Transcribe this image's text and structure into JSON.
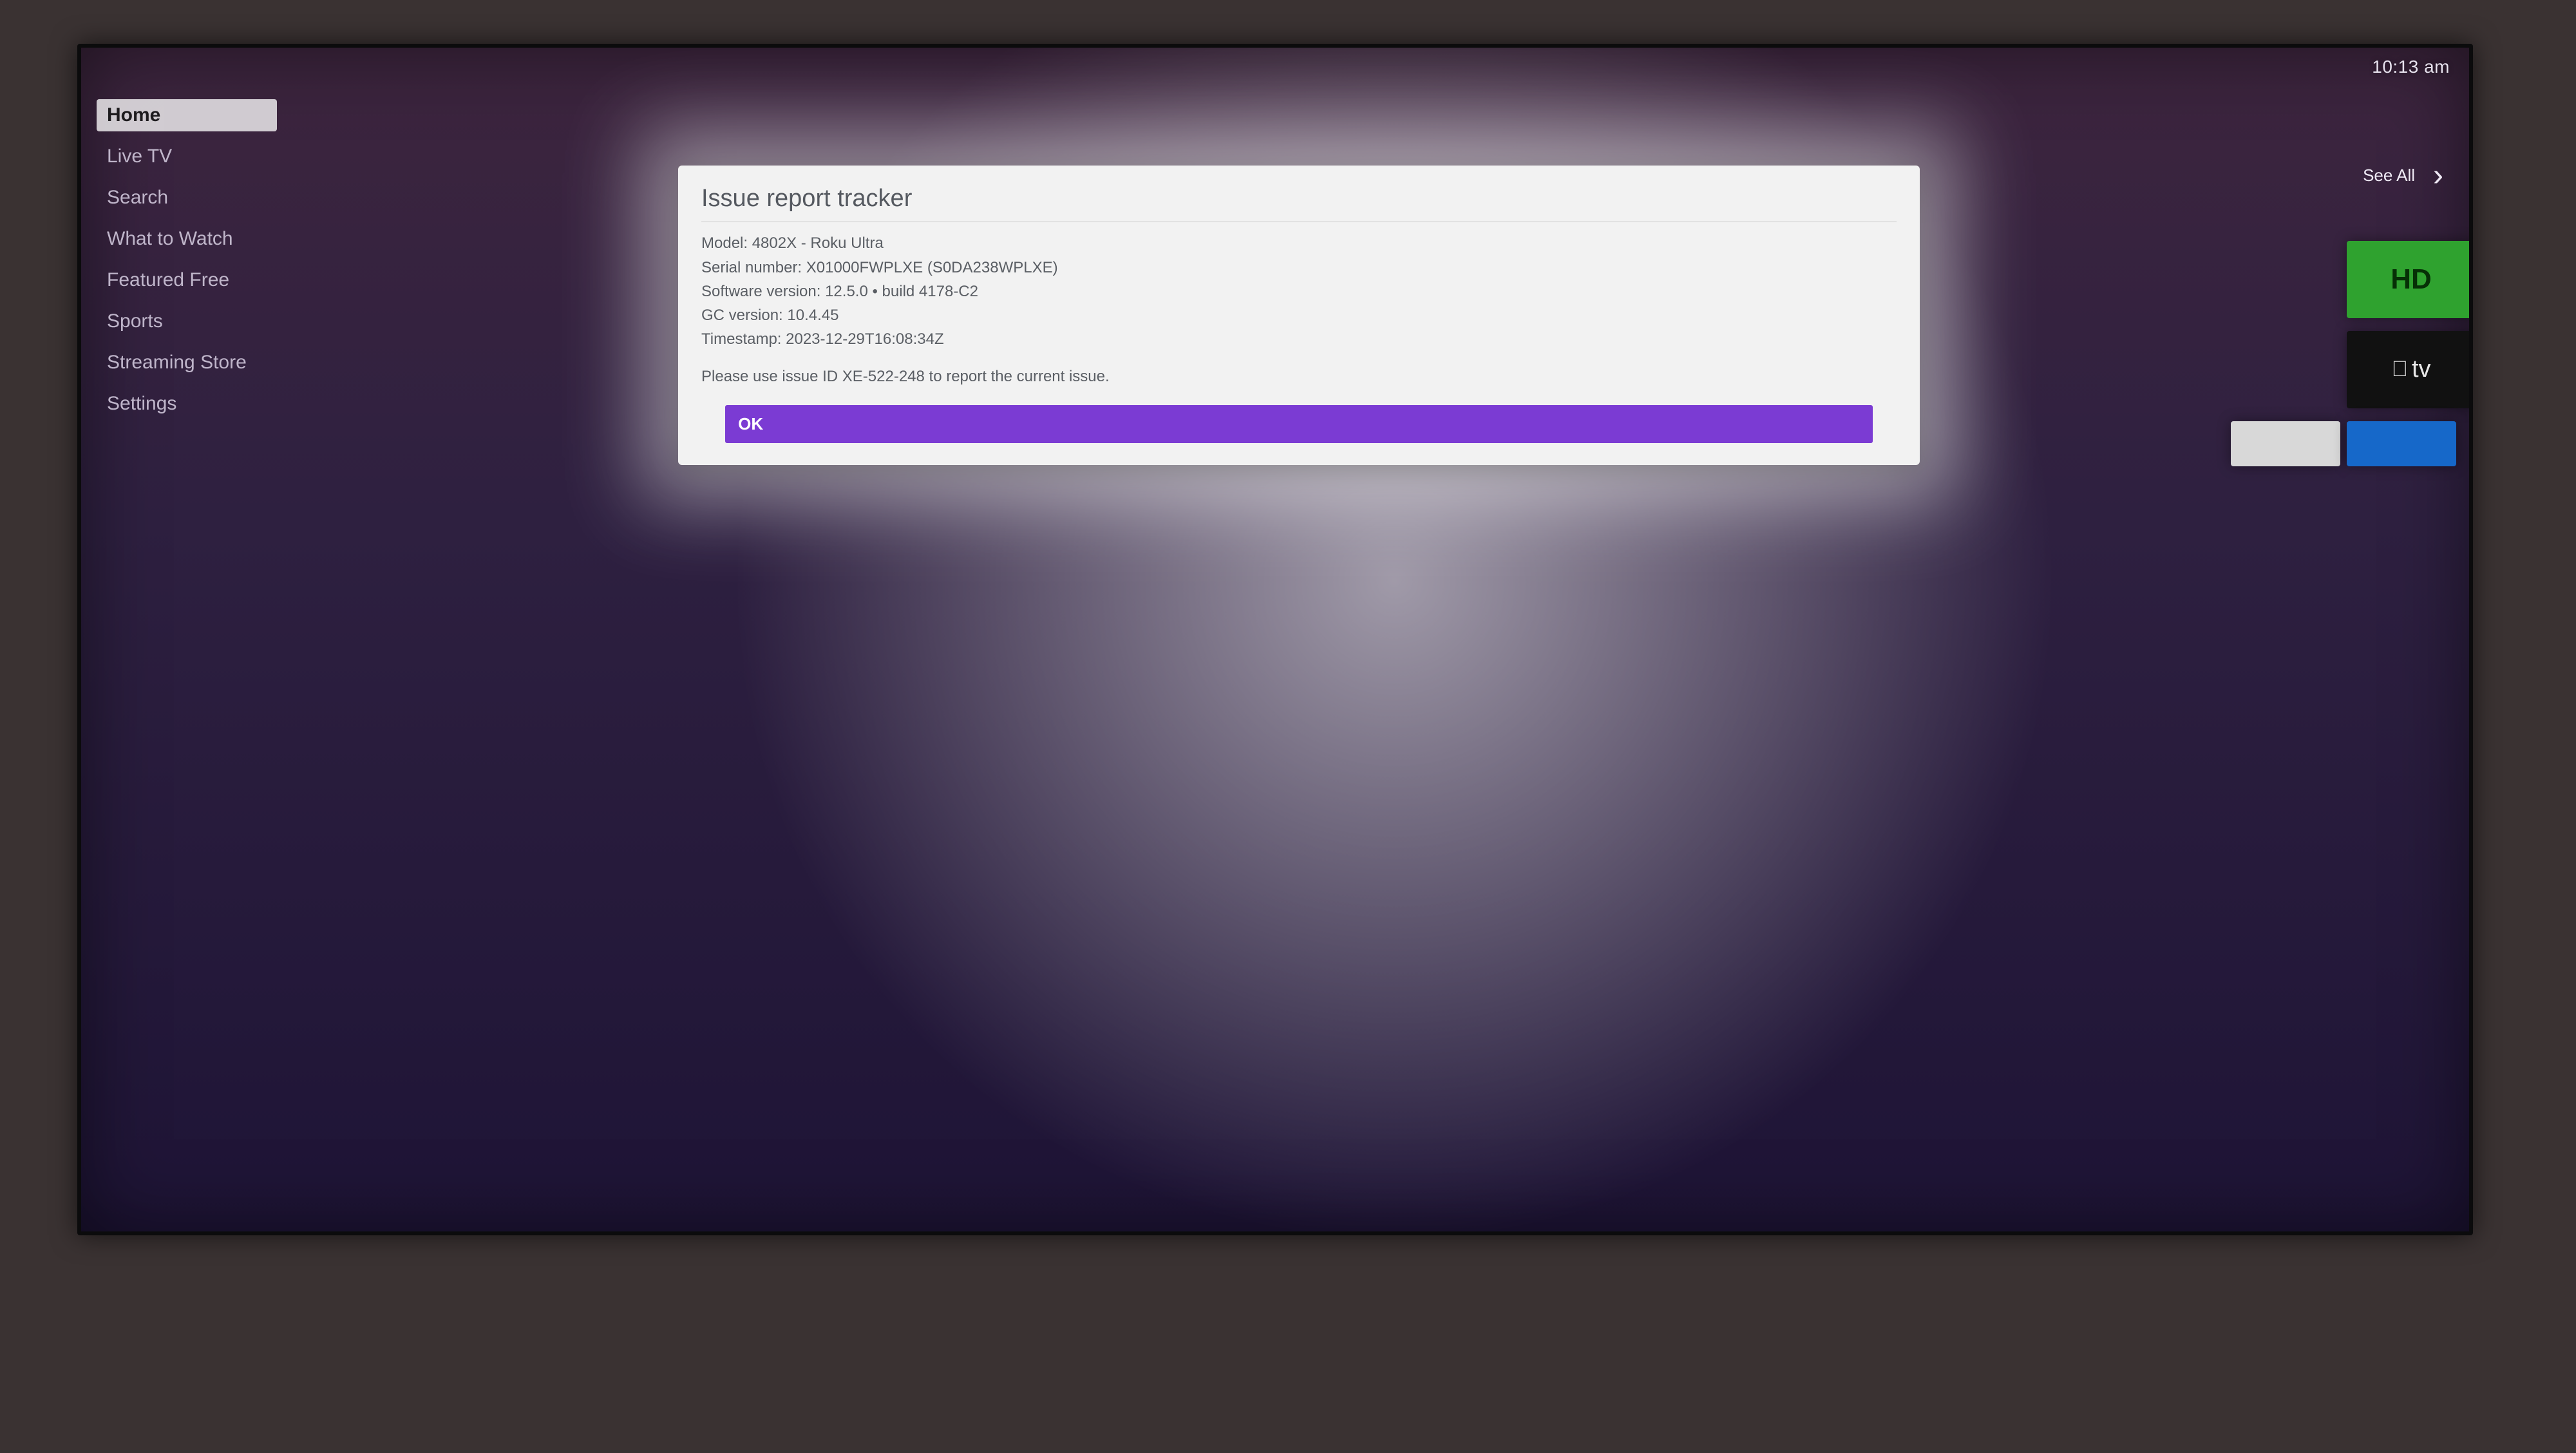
{
  "clock": "10:13 am",
  "sidebar": {
    "items": [
      {
        "label": "Home",
        "selected": true
      },
      {
        "label": "Live TV",
        "selected": false
      },
      {
        "label": "Search",
        "selected": false
      },
      {
        "label": "What to Watch",
        "selected": false
      },
      {
        "label": "Featured Free",
        "selected": false
      },
      {
        "label": "Sports",
        "selected": false
      },
      {
        "label": "Streaming Store",
        "selected": false
      },
      {
        "label": "Settings",
        "selected": false
      }
    ]
  },
  "see_all_label": "See All",
  "tiles": {
    "hd_label": "HD",
    "appletv_label": "tv"
  },
  "dialog": {
    "title": "Issue report tracker",
    "model_line": "Model: 4802X - Roku Ultra",
    "serial_line": "Serial number: X01000FWPLXE (S0DA238WPLXE)",
    "software_line": "Software version: 12.5.0 • build 4178-C2",
    "gc_line": "GC version: 10.4.45",
    "timestamp_line": "Timestamp: 2023-12-29T16:08:34Z",
    "instruction": "Please use issue ID XE-522-248 to report the current issue.",
    "ok_label": "OK"
  }
}
